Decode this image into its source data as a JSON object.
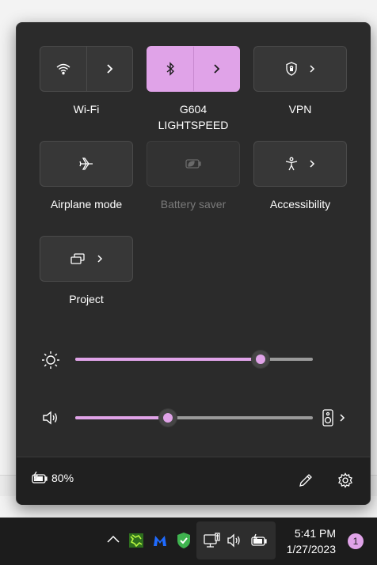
{
  "colors": {
    "accent": "#e0a3e8",
    "panel": "#2b2b2b",
    "tile": "#373737",
    "taskbar": "#1c1c1c"
  },
  "tiles": [
    {
      "label": "Wi-Fi",
      "icon": "wifi-icon",
      "state": "off",
      "has_chevron": true
    },
    {
      "label_line1": "G604",
      "label_line2": "LIGHTSPEED",
      "icon": "bluetooth-icon",
      "state": "on",
      "has_chevron": true
    },
    {
      "label": "VPN",
      "icon": "shield-icon",
      "state": "off",
      "has_chevron": true
    },
    {
      "label": "Airplane mode",
      "icon": "airplane-icon",
      "state": "off",
      "has_chevron": false
    },
    {
      "label": "Battery saver",
      "icon": "battery-saver-icon",
      "state": "disabled",
      "has_chevron": false
    },
    {
      "label": "Accessibility",
      "icon": "accessibility-icon",
      "state": "off",
      "has_chevron": true
    },
    {
      "label": "Project",
      "icon": "project-icon",
      "state": "off",
      "has_chevron": true
    }
  ],
  "brightness": {
    "icon": "sun-icon",
    "value_fraction": 0.78
  },
  "volume": {
    "icon": "speaker-icon",
    "value_fraction": 0.39,
    "output_icon": "speaker-device-icon"
  },
  "footer": {
    "battery_icon": "battery-charging-icon",
    "battery_text": "80%",
    "edit_icon": "pencil-icon",
    "settings_icon": "gear-icon"
  },
  "taskbar": {
    "tray_icons": [
      "chevron-up-icon",
      "green-app-icon",
      "malwarebytes-icon",
      "shield-check-icon"
    ],
    "system_icons": [
      "network-icon",
      "volume-icon",
      "battery-icon"
    ],
    "time": "5:41 PM",
    "date": "1/27/2023",
    "notification_count": "1"
  }
}
